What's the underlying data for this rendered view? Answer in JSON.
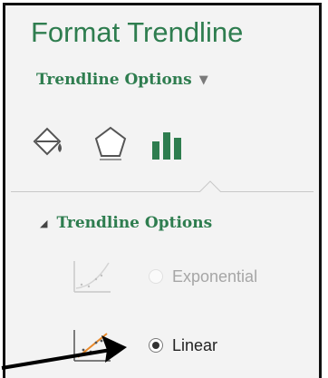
{
  "pane": {
    "title": "Format Trendline"
  },
  "options_dropdown": {
    "label": "Trendline Options",
    "caret": "▼"
  },
  "tabs": [
    {
      "icon": "paint-bucket-icon",
      "name": "Fill & Line"
    },
    {
      "icon": "pentagon-icon",
      "name": "Effects"
    },
    {
      "icon": "bar-chart-icon",
      "name": "Trendline Options",
      "selected": true
    }
  ],
  "section": {
    "label": "Trendline Options",
    "expanded": true,
    "triangle": "◢"
  },
  "trend_types": [
    {
      "label": "Exponential",
      "checked": false,
      "disabled": true,
      "icon": "exponential-trend-icon"
    },
    {
      "label": "Linear",
      "checked": true,
      "disabled": false,
      "icon": "linear-trend-icon"
    }
  ],
  "colors": {
    "accent": "#2e7d4f",
    "pane_bg": "#f3f3f3",
    "trend_line": "#e8892a"
  }
}
